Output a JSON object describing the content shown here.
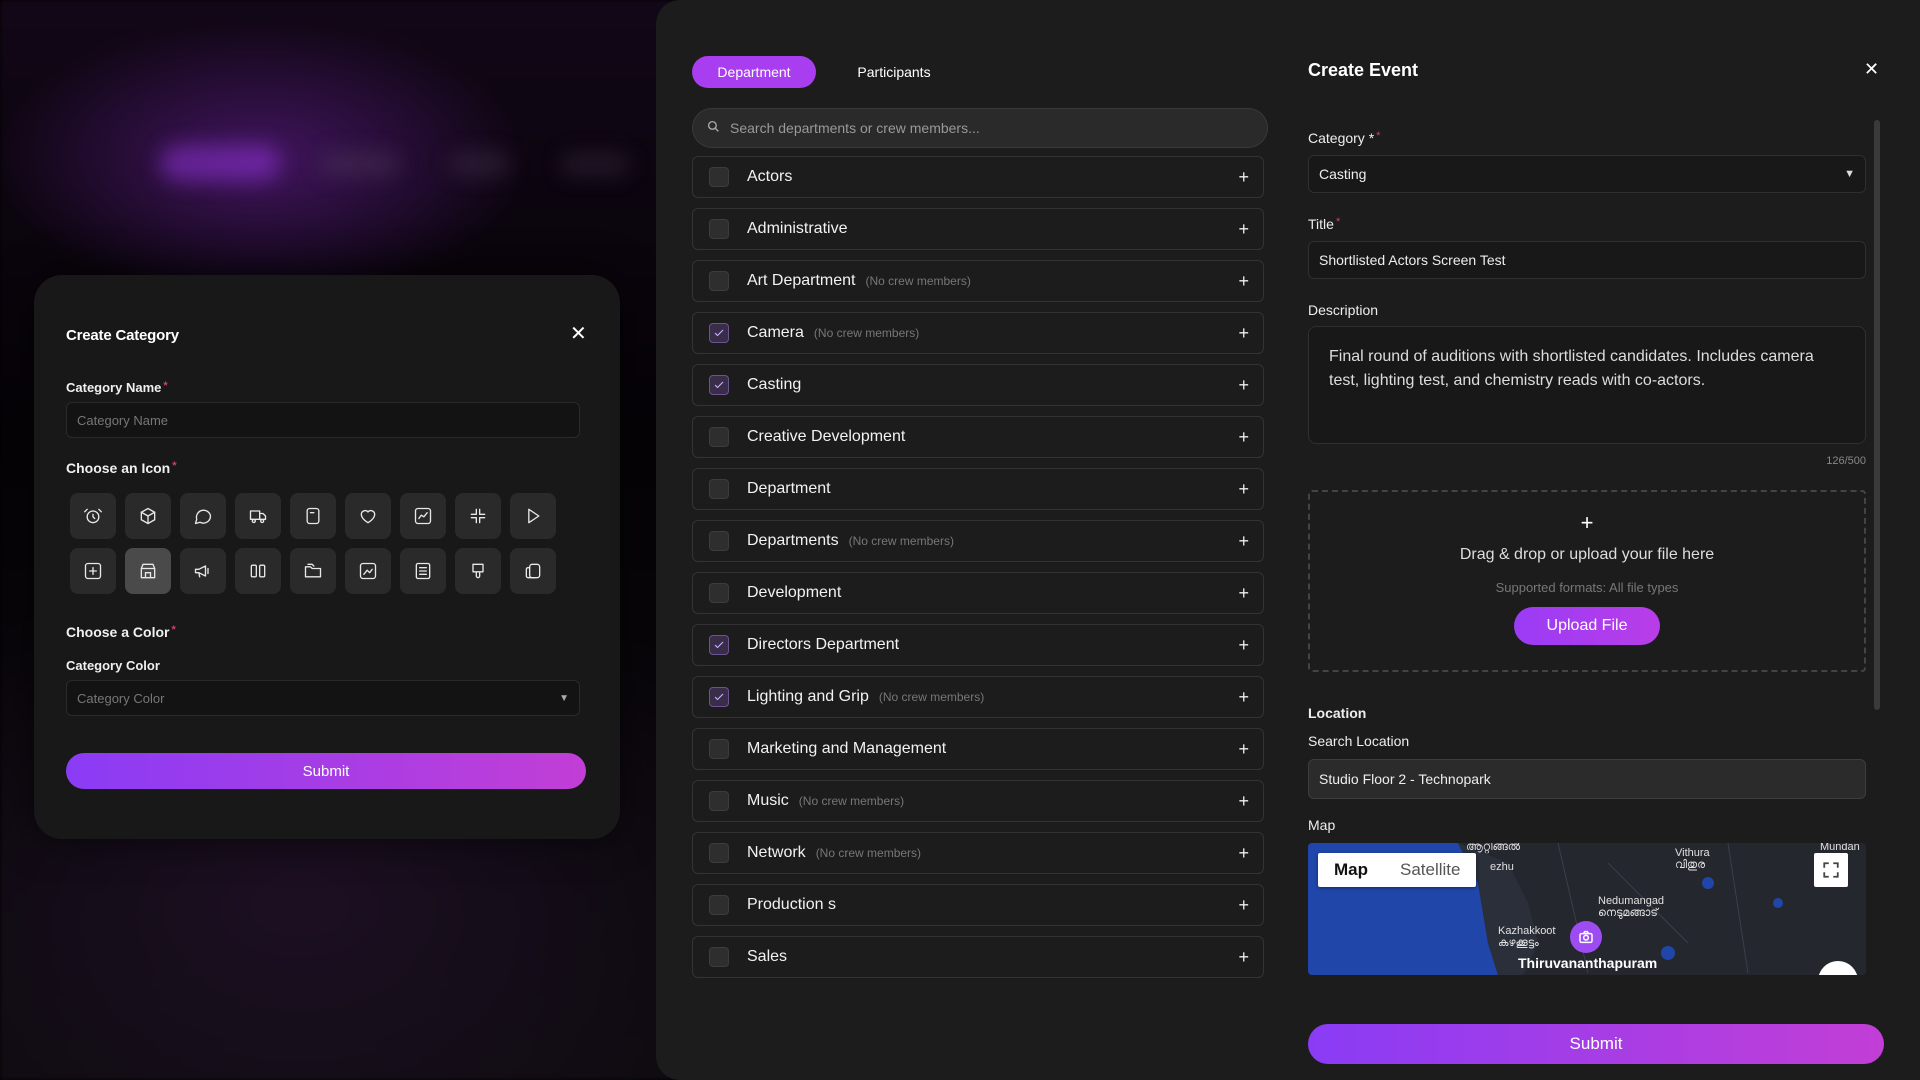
{
  "category_modal": {
    "title": "Create Category",
    "name_label": "Category Name",
    "name_placeholder": "Category Name",
    "icon_label": "Choose an Icon",
    "icons": [
      "alarm-clock-icon",
      "package-icon",
      "message-circle-icon",
      "truck-icon",
      "tablet-icon",
      "heart-icon",
      "chart-icon",
      "shrink-icon",
      "play-icon",
      "plus-square-icon",
      "store-icon",
      "megaphone-icon",
      "columns-icon",
      "folders-icon",
      "image-chart-icon",
      "list-icon",
      "thumbs-down-icon",
      "copy-icon"
    ],
    "selected_icon": "store-icon",
    "color_section_label": "Choose a Color",
    "color_label": "Category Color",
    "color_placeholder": "Category Color",
    "submit_label": "Submit"
  },
  "tabs": [
    {
      "label": "Department",
      "active": true
    },
    {
      "label": "Participants",
      "active": false
    }
  ],
  "search": {
    "placeholder": "Search departments or crew members..."
  },
  "departments": [
    {
      "name": "Actors",
      "note": "",
      "checked": false
    },
    {
      "name": "Administrative",
      "note": "",
      "checked": false
    },
    {
      "name": "Art Department",
      "note": "(No crew members)",
      "checked": false
    },
    {
      "name": "Camera",
      "note": "(No crew members)",
      "checked": true
    },
    {
      "name": "Casting",
      "note": "",
      "checked": true
    },
    {
      "name": "Creative Development",
      "note": "",
      "checked": false
    },
    {
      "name": "Department",
      "note": "",
      "checked": false
    },
    {
      "name": "Departments",
      "note": "(No crew members)",
      "checked": false
    },
    {
      "name": "Development",
      "note": "",
      "checked": false
    },
    {
      "name": "Directors Department",
      "note": "",
      "checked": true
    },
    {
      "name": "Lighting and Grip",
      "note": "(No crew members)",
      "checked": true
    },
    {
      "name": "Marketing and Management",
      "note": "",
      "checked": false
    },
    {
      "name": "Music",
      "note": "(No crew members)",
      "checked": false
    },
    {
      "name": "Network",
      "note": "(No crew members)",
      "checked": false
    },
    {
      "name": "Production s",
      "note": "",
      "checked": false
    },
    {
      "name": "Sales",
      "note": "",
      "checked": false
    }
  ],
  "event": {
    "title": "Create Event",
    "category_label": "Category *",
    "category_value": "Casting",
    "title_label": "Title",
    "title_value": "Shortlisted Actors Screen Test",
    "description_label": "Description",
    "description_value": "Final round of auditions with shortlisted candidates. Includes camera test, lighting test, and chemistry reads with co-actors.",
    "char_count": "126/500",
    "upload_plus": "+",
    "upload_text": "Drag & drop or upload your file here",
    "upload_formats": "Supported formats: All file types",
    "upload_button": "Upload File",
    "location_heading": "Location",
    "search_location_label": "Search Location",
    "search_location_value": "Studio Floor 2 - Technopark",
    "map_label": "Map",
    "map_tab_map": "Map",
    "map_tab_satellite": "Satellite",
    "map_places": [
      "Vithura\nവിതുര",
      "Nedumangad\nനെടുമങ്ങാട്",
      "Kazhakkoottam\nകഴക്കൂട്ടം",
      "Thiruvananthapuram",
      "Mundan",
      "ആറ്റിങ്ങൽ",
      "ezhu"
    ],
    "submit_label": "Submit"
  },
  "colors": {
    "accent": "#a83ef0",
    "gradient_start": "#8a3cf5",
    "gradient_end": "#c23ed6",
    "required": "#d23c6e"
  }
}
